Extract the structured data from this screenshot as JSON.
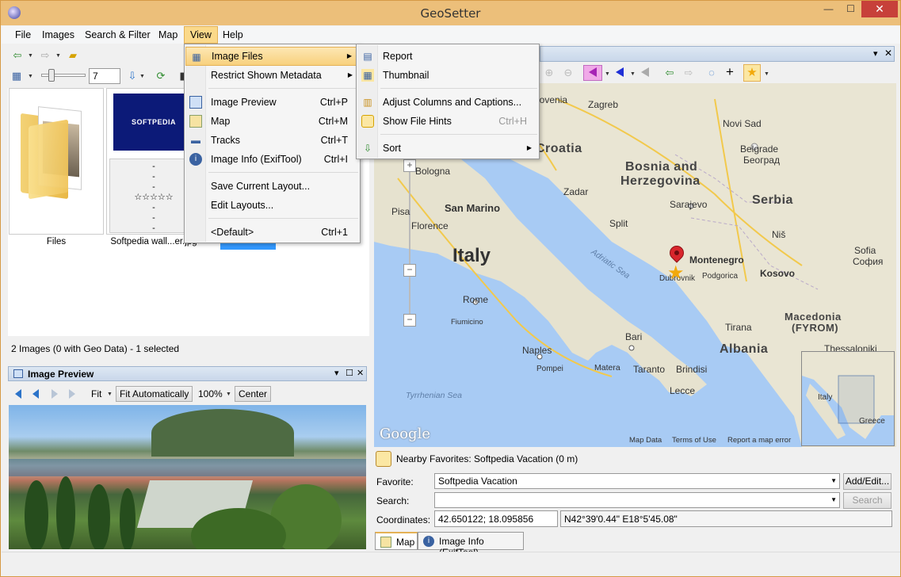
{
  "window": {
    "title": "GeoSetter",
    "controls": {
      "minimize": "—",
      "maximize": "☐",
      "close": "✕"
    }
  },
  "menubar": {
    "items": [
      "File",
      "Images",
      "Search & Filter",
      "Map",
      "View",
      "Help"
    ],
    "active": "View"
  },
  "toolbar": {
    "thumb_size": "7"
  },
  "images_panel": {
    "thumbs": [
      {
        "caption": "Files"
      },
      {
        "caption": "Softpedia wall...er.jpg",
        "logo_text": "SOFTPEDIA",
        "info_lines": [
          "-",
          "-",
          "-",
          "☆☆☆☆☆",
          "-",
          "-",
          "-"
        ]
      }
    ],
    "status": "2 Images (0 with Geo Data) - 1 selected"
  },
  "image_preview": {
    "title": "Image Preview",
    "zoom_mode": "Fit",
    "fit_button": "Fit Automatically",
    "zoom": "100%",
    "center_button": "Center"
  },
  "view_menu": {
    "items": [
      {
        "label": "Image Files",
        "shortcut": "",
        "submenu": true,
        "icon": "table-icon"
      },
      {
        "label": "Restrict Shown Metadata",
        "shortcut": "",
        "submenu": true,
        "icon": ""
      },
      {
        "label": "Image Preview",
        "shortcut": "Ctrl+P",
        "icon": "preview-icon"
      },
      {
        "label": "Map",
        "shortcut": "Ctrl+M",
        "icon": "map-icon"
      },
      {
        "label": "Tracks",
        "shortcut": "Ctrl+T",
        "icon": "car-icon"
      },
      {
        "label": "Image Info (ExifTool)",
        "shortcut": "Ctrl+I",
        "icon": "info-icon"
      },
      {
        "label": "Save Current Layout...",
        "shortcut": "",
        "icon": ""
      },
      {
        "label": "Edit Layouts...",
        "shortcut": "",
        "icon": ""
      },
      {
        "label": "<Default>",
        "shortcut": "Ctrl+1",
        "icon": ""
      }
    ]
  },
  "image_files_submenu": {
    "items": [
      {
        "label": "Report",
        "shortcut": "",
        "icon": "report-icon"
      },
      {
        "label": "Thumbnail",
        "shortcut": "",
        "icon": "thumbnail-icon"
      },
      {
        "label": "Adjust Columns and Captions...",
        "shortcut": "",
        "icon": "columns-icon"
      },
      {
        "label": "Show File Hints",
        "shortcut": "Ctrl+H",
        "icon": "hint-icon"
      },
      {
        "label": "Sort",
        "shortcut": "",
        "icon": "sort-icon",
        "submenu": true
      }
    ]
  },
  "map": {
    "labels": {
      "slovenia": "lovenia",
      "zagreb": "Zagreb",
      "novi_sad": "Novi Sad",
      "belgrade": "Belgrade",
      "beograd": "Београд",
      "croatia": "Croatia",
      "bosnia": "Bosnia and",
      "herzegovina": "Herzegovina",
      "sarajevo": "Sarajevo",
      "serbia": "Serbia",
      "bologna": "Bologna",
      "zadar": "Zadar",
      "pisa": "Pisa",
      "san_marino": "San Marino",
      "split": "Split",
      "nis": "Niš",
      "florence": "Florence",
      "montenegro": "Montenegro",
      "dubrovnik": "Dubrovnik",
      "podgorica": "Podgorica",
      "kosovo": "Kosovo",
      "sofia": "Sofia",
      "sofia_cyr": "София",
      "italy": "Italy",
      "adriatic": "Adriatic Sea",
      "rome": "Rome",
      "fiumicino": "Fiumicino",
      "tirana": "Tirana",
      "macedonia": "Macedonia",
      "fyrom": "(FYROM)",
      "bari": "Bari",
      "albania": "Albania",
      "thessaloniki": "Thessaloniki",
      "naples": "Naples",
      "pompei": "Pompei",
      "matera": "Matera",
      "taranto": "Taranto",
      "brindisi": "Brindisi",
      "lecce": "Lecce",
      "tyrrhenian": "Tyrrhenian Sea"
    },
    "minimap": {
      "italy": "Italy",
      "greece": "Greece"
    },
    "google": "Google",
    "footer": [
      "Map Data",
      "Terms of Use",
      "Report a map error"
    ]
  },
  "favorites": {
    "header": "Nearby Favorites: Softpedia Vacation (0 m)",
    "favorite_label": "Favorite:",
    "favorite_value": "Softpedia Vacation",
    "add_edit": "Add/Edit...",
    "search_label": "Search:",
    "search_value": "",
    "search_button": "Search",
    "coordinates_label": "Coordinates:",
    "coordinates_decimal": "42.650122; 18.095856",
    "coordinates_dms": "N42°39'0.44\" E18°5'45.08\""
  },
  "bottom_tabs": [
    {
      "label": "Map",
      "active": true
    },
    {
      "label": "Image Info (ExifTool)",
      "active": false
    }
  ],
  "colors": {
    "title_bar": "#ecbf7a",
    "menu_highlight": "#fbd98a",
    "map_water": "#a8cbf4",
    "map_land": "#e8e3d4",
    "pin": "#d8262c"
  }
}
